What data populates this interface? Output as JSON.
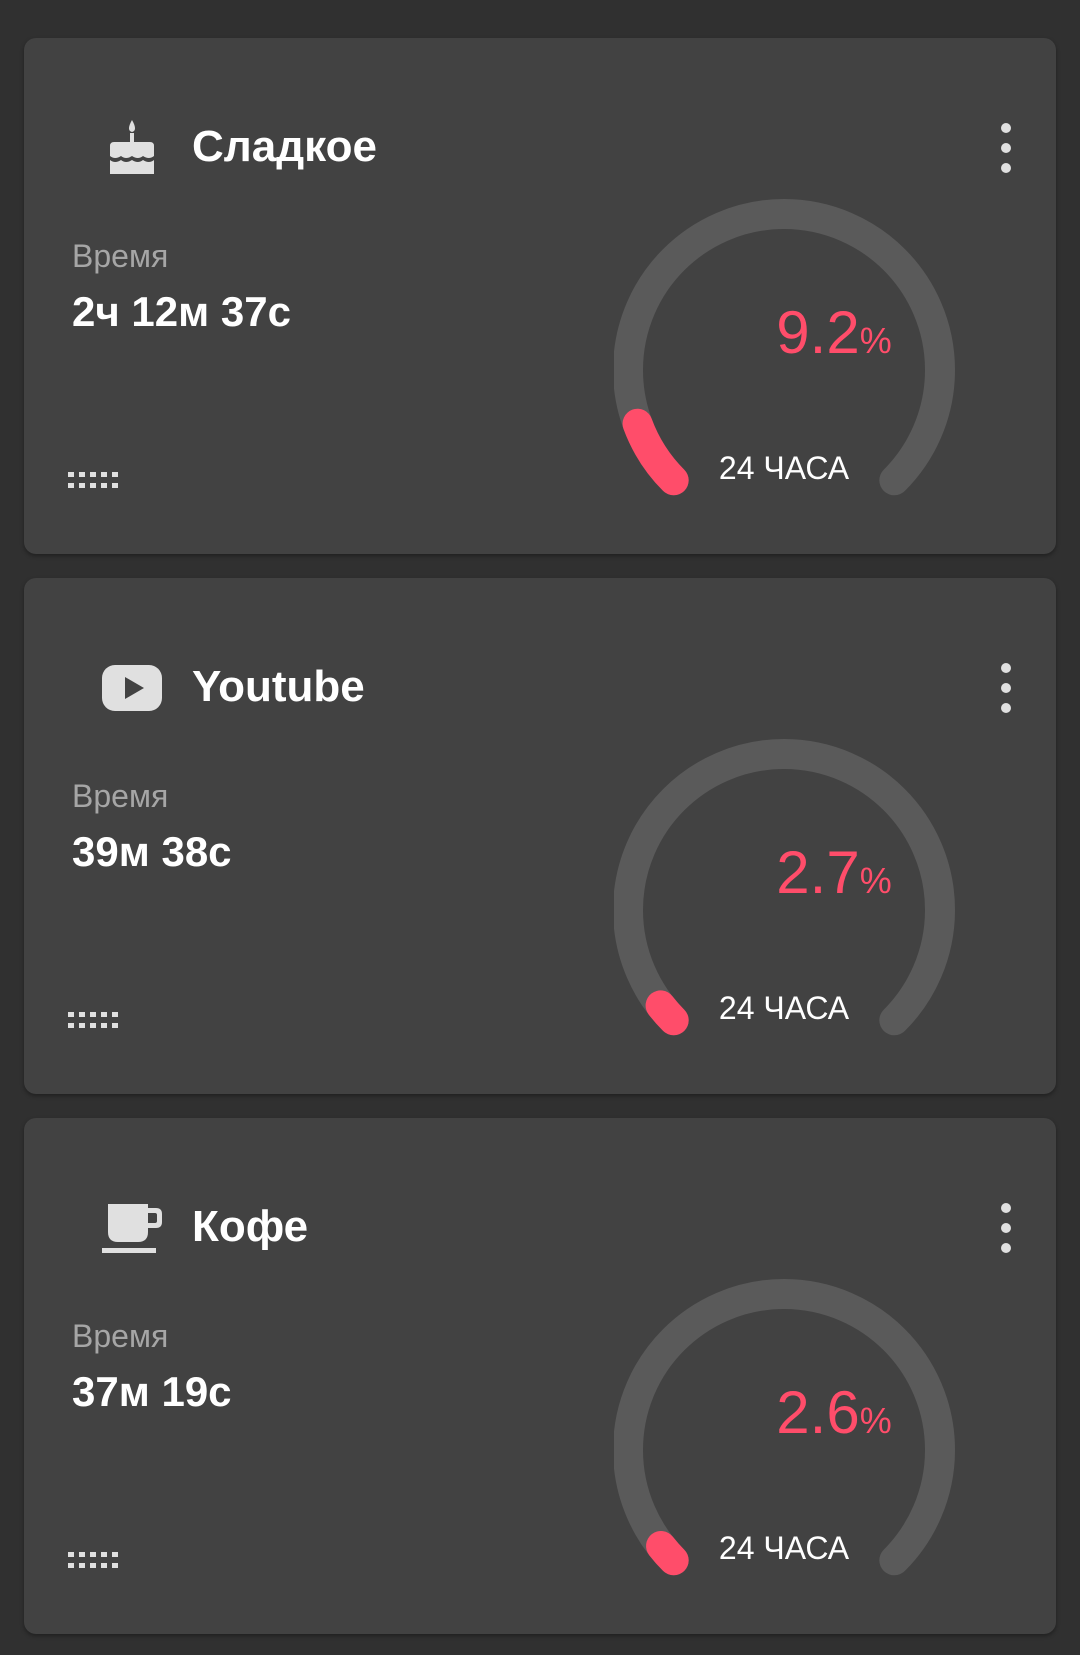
{
  "colors": {
    "background": "#303030",
    "card": "#424242",
    "track": "#5a5a5a",
    "accent": "#ff4d6a",
    "icon": "#e0e0e0",
    "label": "#a6a6a6"
  },
  "cards": [
    {
      "icon": "cake-icon",
      "title": "Сладкое",
      "time_label": "Время",
      "time_value": "2ч 12м 37с",
      "percent_value": "9.2",
      "percent_unit": "%",
      "percent": 9.2,
      "period_label": "24 ЧАСА"
    },
    {
      "icon": "youtube-icon",
      "title": "Youtube",
      "time_label": "Время",
      "time_value": "39м 38с",
      "percent_value": "2.7",
      "percent_unit": "%",
      "percent": 2.7,
      "period_label": "24 ЧАСА"
    },
    {
      "icon": "coffee-cup-icon",
      "title": "Кофе",
      "time_label": "Время",
      "time_value": "37м 19с",
      "percent_value": "2.6",
      "percent_unit": "%",
      "percent": 2.6,
      "period_label": "24 ЧАСА"
    }
  ]
}
